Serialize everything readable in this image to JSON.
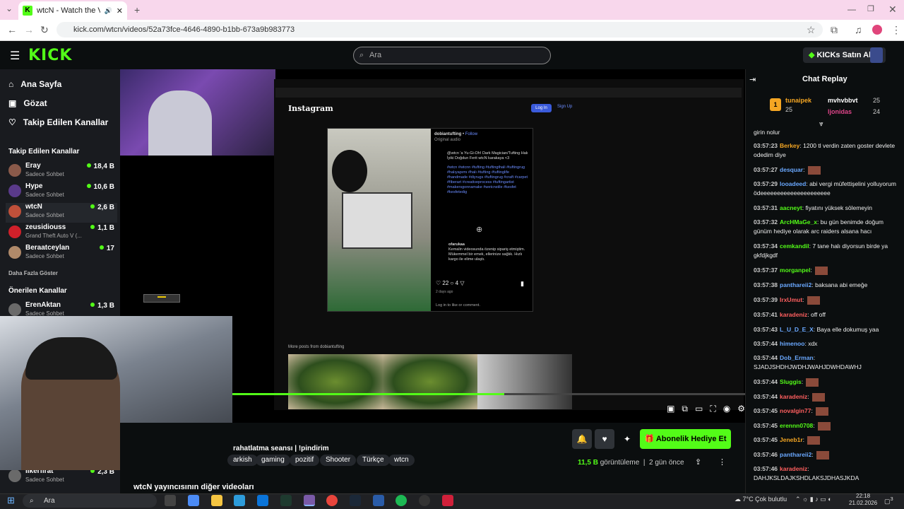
{
  "browser": {
    "tab_title": "wtcN - Watch the VOD on K",
    "url": "kick.com/wtcn/videos/52a73fce-4646-4890-b1bb-673a9b983773"
  },
  "header": {
    "logo": "KICK",
    "search_placeholder": "Ara",
    "kicks_button": "KICKs Satın Al"
  },
  "sidebar": {
    "nav": [
      "Ana Sayfa",
      "Gözat",
      "Takip Edilen Kanallar"
    ],
    "followed_title": "Takip Edilen Kanallar",
    "followed": [
      {
        "name": "Eray",
        "sub": "Sadece Sohbet",
        "viewers": "18,4 B"
      },
      {
        "name": "Hype",
        "sub": "Sadece Sohbet",
        "viewers": "10,6 B"
      },
      {
        "name": "wtcN",
        "sub": "Sadece Sohbet",
        "viewers": "2,6 B"
      },
      {
        "name": "zeusidiouss",
        "sub": "Grand Theft Auto V (...",
        "viewers": "1,1 B"
      },
      {
        "name": "Beraatceylan",
        "sub": "Sadece Sohbet",
        "viewers": "17"
      }
    ],
    "show_more": "Daha Fazla Göster",
    "recommended_title": "Önerilen Kanallar",
    "recommended": [
      {
        "name": "ErenAktan",
        "sub": "Sadece Sohbet",
        "viewers": "1,3 B"
      },
      {
        "name": "ilkerfırat",
        "sub": "Sadece Sohbet",
        "viewers": "2,3 B"
      }
    ]
  },
  "player": {
    "instagram": {
      "brand": "Instagram",
      "login": "Log In",
      "signup": "Sign Up",
      "account": "dobiantufting",
      "follow": "Follow",
      "audio": "Original audio",
      "caption": "@wtcn 'a Yu-Gi-Oh! Dark Magician/Tufting Halı İyiki Doğdun Ferit wtcN karakaya <3",
      "hashtags": "#wtcn #wtcnn #tufting #tuftingthali #tuftingrug #halıyapımı #halı #tufting #tuftinglife #handmade #diyrugs #tuftingrug #craft #carpet #fiberart #creativeprocess #tuftingartist #makersgonnamake #wetcnstile #kesfet #kesfetedig",
      "commenter": "ofarukaa",
      "comment": "Kemalin videosunda özenip sipariş etmiştim. Mükemmel bir emek, ellerinize sağlık. Hızlı kargo ile elime ulaştı.",
      "likes": "22",
      "comments_count": "4",
      "days_ago": "2 days ago",
      "login_prompt": "Log in to like or comment.",
      "more_posts": "More posts from dobiantufting"
    },
    "progress": 0.53
  },
  "video": {
    "title": "rahatlatma seansı | !pindirim",
    "tags": [
      "arkish",
      "gaming",
      "pozitif",
      "Shooter",
      "Türkçe",
      "wtcn"
    ],
    "subscribe_button": "Abonelik Hediye Et",
    "views_count": "11,5 B",
    "views_label": "görüntüleme",
    "date": "2 gün önce",
    "other_videos": "wtcN yayıncısının diğer videoları"
  },
  "chat": {
    "title": "Chat Replay",
    "gifters": [
      {
        "name": "tunaipek",
        "count": "25"
      },
      {
        "name": "mvhvbbvt",
        "count": "25"
      },
      {
        "name": "ljonidas",
        "count": "24"
      }
    ],
    "messages": [
      {
        "time": "",
        "user": "",
        "color": "#ffffff",
        "text": "girin nolur"
      },
      {
        "time": "03:57:23",
        "user": "Berkey",
        "color": "#f5a623",
        "text": "1200 tl verdin zaten goster devlete odedim diye"
      },
      {
        "time": "03:57:27",
        "user": "desquar",
        "color": "#6aa8ff",
        "text": ""
      },
      {
        "time": "03:57:29",
        "user": "looadeed",
        "color": "#6aa8ff",
        "text": "abi vergi müfettişelini yolluyorum ödeeeeeeeeeeeeeeeeeeeee"
      },
      {
        "time": "03:57:31",
        "user": "aacneyt",
        "color": "#53fc18",
        "text": "fiyatını yüksek sölemeyin"
      },
      {
        "time": "03:57:32",
        "user": "ArcHMaGe_x",
        "color": "#53fc18",
        "text": "bu gün benimde doğum günüm hediye olarak arc raiders alsana hacı"
      },
      {
        "time": "03:57:34",
        "user": "cemkandil",
        "color": "#53fc18",
        "text": "7 tane halı diyorsun birde ya gkfdjkgdf"
      },
      {
        "time": "03:57:37",
        "user": "morganpel",
        "color": "#53fc18",
        "text": ""
      },
      {
        "time": "03:57:38",
        "user": "panthareii2",
        "color": "#6aa8ff",
        "text": "baksana abi emeğe"
      },
      {
        "time": "03:57:39",
        "user": "IrxUmut",
        "color": "#ff5f5f",
        "text": ""
      },
      {
        "time": "03:57:41",
        "user": "karadeniz",
        "color": "#ff5f5f",
        "text": "off off"
      },
      {
        "time": "03:57:43",
        "user": "L_U_D_E_X",
        "color": "#6aa8ff",
        "text": "Baya elle dokumuş yaa"
      },
      {
        "time": "03:57:44",
        "user": "himenoo",
        "color": "#6aa8ff",
        "text": "xdx"
      },
      {
        "time": "03:57:44",
        "user": "Dob_Erman",
        "color": "#6aa8ff",
        "text": "SJADJSHDHJWDHJWAHJDWHDAWHJ"
      },
      {
        "time": "03:57:44",
        "user": "Sluggis",
        "color": "#53fc18",
        "text": ""
      },
      {
        "time": "03:57:44",
        "user": "karadeniz",
        "color": "#ff5f5f",
        "text": ""
      },
      {
        "time": "03:57:45",
        "user": "novalgin77",
        "color": "#ff5f5f",
        "text": ""
      },
      {
        "time": "03:57:45",
        "user": "erennn0708",
        "color": "#53fc18",
        "text": ""
      },
      {
        "time": "03:57:45",
        "user": "Jeneb1r",
        "color": "#f5a623",
        "text": ""
      },
      {
        "time": "03:57:46",
        "user": "panthareii2",
        "color": "#6aa8ff",
        "text": ""
      },
      {
        "time": "03:57:46",
        "user": "karadeniz",
        "color": "#ff5f5f",
        "text": "DAHJKSLDAJKSHDLAKSJDHASJKDA"
      }
    ]
  },
  "taskbar": {
    "search": "Ara",
    "weather": "7°C  Çok bulutlu",
    "time": "22:18",
    "date": "21.02.2026",
    "notif": "3"
  },
  "colors": {
    "accent": "#53fc18",
    "bg": "#0b0e0f",
    "panel": "#191b1f"
  }
}
